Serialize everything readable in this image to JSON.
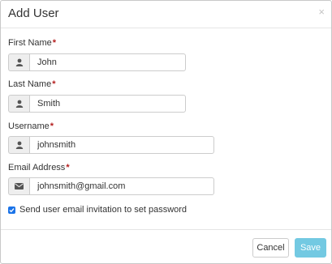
{
  "modal": {
    "title": "Add User",
    "close_label": "×"
  },
  "fields": {
    "first_name": {
      "label": "First Name",
      "required_mark": "*",
      "value": "John",
      "icon": "user-icon"
    },
    "last_name": {
      "label": "Last Name",
      "required_mark": "*",
      "value": "Smith",
      "icon": "user-icon"
    },
    "username": {
      "label": "Username",
      "required_mark": "*",
      "value": "johnsmith",
      "icon": "user-icon"
    },
    "email": {
      "label": "Email Address",
      "required_mark": "*",
      "value": "johnsmith@gmail.com",
      "icon": "envelope-icon"
    }
  },
  "invite": {
    "checked": true,
    "label": "Send user email invitation to set password"
  },
  "footer": {
    "cancel_label": "Cancel",
    "save_label": "Save"
  },
  "colors": {
    "accent": "#5bc0de",
    "checkbox": "#1a73e8",
    "required": "#b41e1e"
  }
}
